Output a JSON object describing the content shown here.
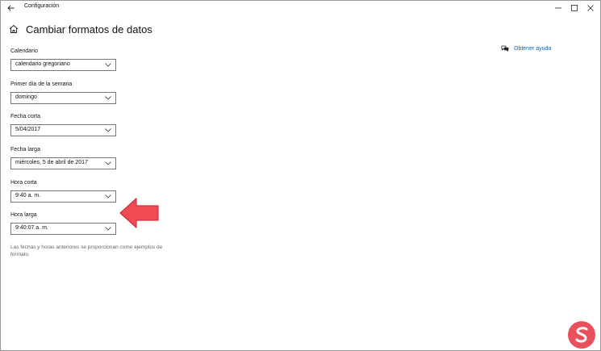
{
  "window": {
    "title": "Configuración",
    "icons": {
      "back": "back-arrow-icon",
      "minimize": "minimize-icon",
      "maximize": "maximize-icon",
      "close": "close-icon"
    }
  },
  "header": {
    "title": "Cambiar formatos de datos",
    "icon": "home-icon"
  },
  "help": {
    "label": "Obtener ayuda",
    "icon": "chat-help-icon"
  },
  "fields": [
    {
      "label": "Calendario",
      "value": "calendario gregoriano"
    },
    {
      "label": "Primer día de la semana",
      "value": "domingo"
    },
    {
      "label": "Fecha corta",
      "value": "5/04/2017"
    },
    {
      "label": "Fecha larga",
      "value": "miércoles, 5 de abril de 2017"
    },
    {
      "label": "Hora corta",
      "value": "9:40 a. m."
    },
    {
      "label": "Hora larga",
      "value": "9:40:07 a. m."
    }
  ],
  "footnote": "Las fechas y horas anteriores se proporcionan como ejemplos de formato.",
  "colors": {
    "accent": "#0067b8",
    "annotation_arrow": "#f04b55",
    "logo": "#e8505b"
  }
}
